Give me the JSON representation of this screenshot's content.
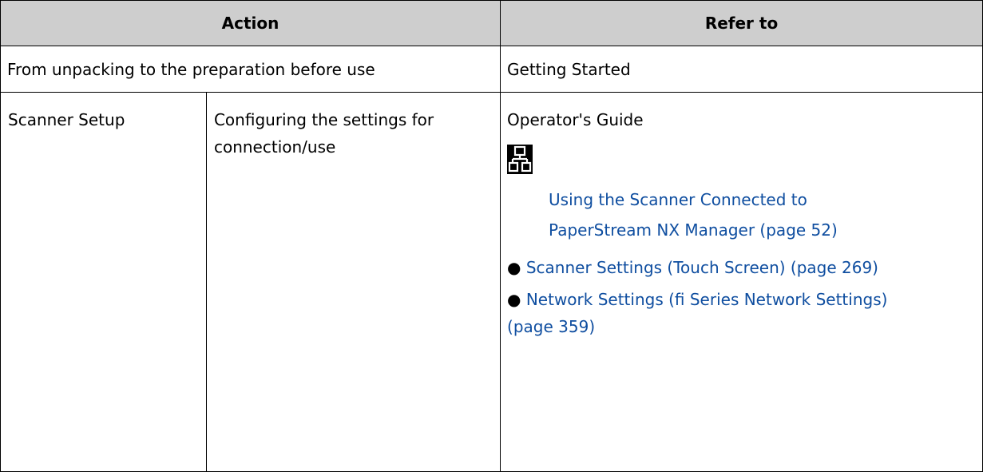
{
  "table": {
    "header": {
      "action": "Action",
      "refer_to": "Refer to"
    },
    "row1": {
      "action": "From unpacking to the preparation before use",
      "refer": "Getting Started"
    },
    "row2": {
      "category": "Scanner Setup",
      "task_line1": "Configuring the settings for",
      "task_line2": "connection/use",
      "refer_title": "Operator's Guide",
      "icon": "network-icon",
      "link1_line1": "Using the Scanner Connected to",
      "link1_line2": "PaperStream NX Manager (page 52)",
      "bullet_symbol": "●",
      "link2": "Scanner Settings (Touch Screen) (page 269)",
      "link3_line1": "Network Settings (fi Series Network Settings)",
      "link3_line2": "(page 359)"
    }
  }
}
